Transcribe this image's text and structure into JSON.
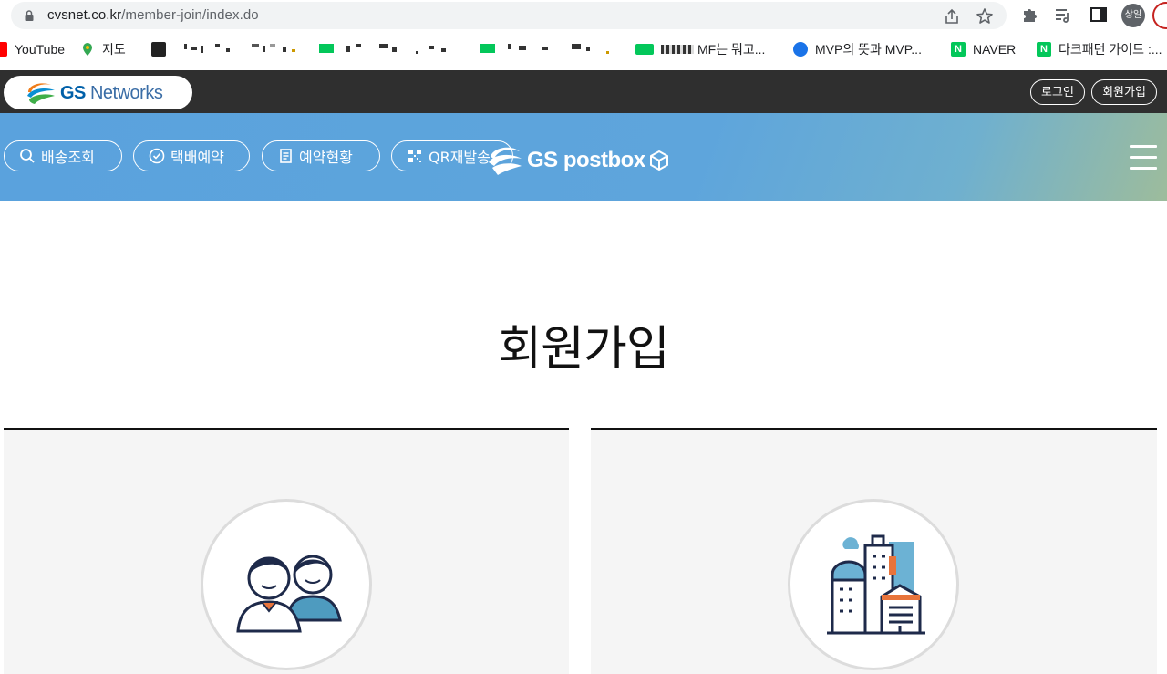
{
  "browser": {
    "url_host": "cvsnet.co.kr",
    "url_path": "/member-join/index.do",
    "profile_label": "상일"
  },
  "bookmarks": [
    {
      "label": "YouTube",
      "color": "#ff0000"
    },
    {
      "label": "지도",
      "color": "#34a853"
    },
    {
      "label": "MF는 뭐고...",
      "color": "#03c75a"
    },
    {
      "label": "MVP의 뜻과 MVP...",
      "color": "#1a73e8"
    },
    {
      "label": "NAVER",
      "color": "#03c75a"
    },
    {
      "label": "다크패턴 가이드 :...",
      "color": "#03c75a"
    }
  ],
  "site": {
    "logo_bold": "GS",
    "logo_light": "Networks",
    "login_label": "로그인",
    "join_label": "회원가입",
    "nav": [
      {
        "label": "배송조회"
      },
      {
        "label": "택배예약"
      },
      {
        "label": "예약현황"
      },
      {
        "label": "QR재발송"
      }
    ],
    "postbox_label": "GS postbox",
    "brand_color": "#5aa2dd"
  },
  "main": {
    "title": "회원가입"
  }
}
